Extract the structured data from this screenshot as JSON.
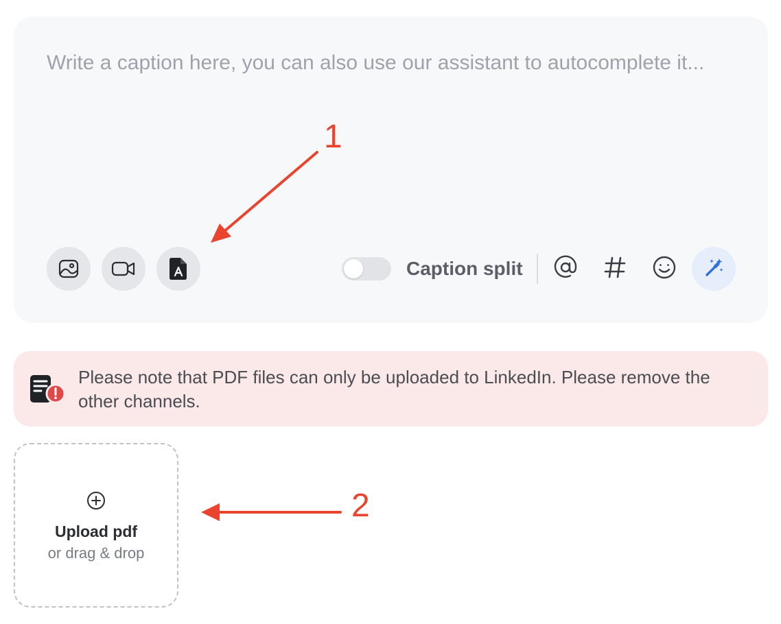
{
  "composer": {
    "caption_placeholder": "Write a caption here, you can also use our assistant to autocomplete it...",
    "caption_value": "",
    "media_buttons": [
      {
        "icon": "image-icon"
      },
      {
        "icon": "video-icon"
      },
      {
        "icon": "pdf-file-icon"
      }
    ],
    "caption_split": {
      "label": "Caption split",
      "enabled": false
    },
    "tools": [
      {
        "icon": "at-mention-icon"
      },
      {
        "icon": "hashtag-icon"
      },
      {
        "icon": "emoji-icon"
      },
      {
        "icon": "magic-wand-icon",
        "active": true
      }
    ]
  },
  "alert": {
    "icon": "document-warning-icon",
    "message": "Please note that PDF files can only be uploaded to LinkedIn. Please remove the other channels."
  },
  "upload": {
    "icon": "plus-circle-icon",
    "title": "Upload pdf",
    "subtitle": "or drag & drop"
  },
  "annotations": {
    "arrow_1_label": "1",
    "arrow_2_label": "2",
    "color": "#e8442e"
  },
  "colors": {
    "accent_blue": "#2f6fe0",
    "alert_background": "#fbe8e8",
    "alert_badge": "#e0494a"
  }
}
